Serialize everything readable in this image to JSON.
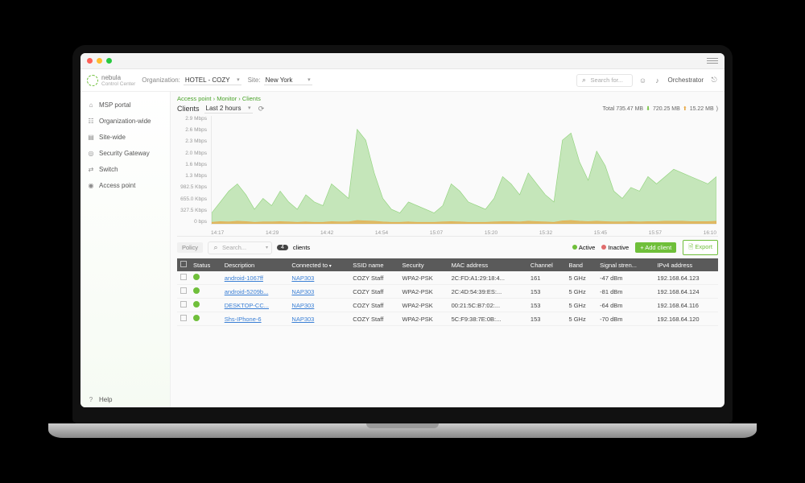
{
  "brand": {
    "name": "nebula",
    "sub": "Control Center"
  },
  "topbar": {
    "org_label": "Organization:",
    "org_value": "HOTEL - COZY",
    "site_label": "Site:",
    "site_value": "New York",
    "search_placeholder": "Search for...",
    "orchestrator": "Orchestrator"
  },
  "sidebar": {
    "items": [
      {
        "icon": "⌂",
        "label": "MSP portal"
      },
      {
        "icon": "☷",
        "label": "Organization-wide"
      },
      {
        "icon": "▤",
        "label": "Site-wide"
      },
      {
        "icon": "◎",
        "label": "Security Gateway"
      },
      {
        "icon": "⇄",
        "label": "Switch"
      },
      {
        "icon": "◉",
        "label": "Access point"
      }
    ],
    "help": {
      "icon": "?",
      "label": "Help"
    }
  },
  "breadcrumb": [
    "Access point",
    "Monitor",
    "Clients"
  ],
  "panel": {
    "title": "Clients",
    "range": "Last 2 hours",
    "total": "Total 735.47 MB",
    "down": "720.25 MB",
    "up": "15.22 MB"
  },
  "toolbar": {
    "policy": "Policy",
    "search": "Search...",
    "count": "4",
    "count_label": "clients",
    "active": "Active",
    "inactive": "Inactive",
    "add": "+ Add client",
    "export": "Export"
  },
  "columns": [
    "",
    "Status",
    "Description",
    "Connected to",
    "SSID name",
    "Security",
    "MAC address",
    "Channel",
    "Band",
    "Signal stren...",
    "IPv4 address"
  ],
  "rows": [
    {
      "desc": "android-1067ff",
      "ap": "NAP303",
      "ssid": "COZY Staff",
      "sec": "WPA2-PSK",
      "mac": "2C:FD:A1:29:18:4...",
      "ch": "161",
      "band": "5 GHz",
      "sig": "-47 dBm",
      "ip": "192.168.64.123"
    },
    {
      "desc": "android-5209b...",
      "ap": "NAP303",
      "ssid": "COZY Staff",
      "sec": "WPA2-PSK",
      "mac": "2C:4D:54:39:ES:...",
      "ch": "153",
      "band": "5 GHz",
      "sig": "-81 dBm",
      "ip": "192.168.64.124"
    },
    {
      "desc": "DESKTOP-CC...",
      "ap": "NAP303",
      "ssid": "COZY Staff",
      "sec": "WPA2-PSK",
      "mac": "00:21:5C:B7:02:...",
      "ch": "153",
      "band": "5 GHz",
      "sig": "-64 dBm",
      "ip": "192.168.64.116"
    },
    {
      "desc": "Shs-IPhone-6",
      "ap": "NAP303",
      "ssid": "COZY Staff",
      "sec": "WPA2-PSK",
      "mac": "5C:F9:38:7E:0B:...",
      "ch": "153",
      "band": "5 GHz",
      "sig": "-70 dBm",
      "ip": "192.168.64.120"
    }
  ],
  "chart_data": {
    "type": "area",
    "title": "",
    "xlabel": "",
    "ylabel": "",
    "yticks": [
      "2.9 Mbps",
      "2.6 Mbps",
      "2.3 Mbps",
      "2.0 Mbps",
      "1.6 Mbps",
      "1.3 Mbps",
      "982.5 Kbps",
      "655.0 Kbps",
      "327.5 Kbps",
      "0 bps"
    ],
    "xticks": [
      "14:17",
      "14:29",
      "14:42",
      "14:54",
      "15:07",
      "15:20",
      "15:32",
      "15:45",
      "15:57",
      "16:10"
    ],
    "ylim_kbps": [
      0,
      2970
    ],
    "series": [
      {
        "name": "download",
        "color": "#8fd27a",
        "values_kbps": [
          300,
          600,
          900,
          1100,
          800,
          400,
          700,
          500,
          900,
          600,
          400,
          800,
          600,
          500,
          1100,
          900,
          700,
          2600,
          2300,
          1400,
          700,
          400,
          300,
          600,
          500,
          400,
          300,
          500,
          1100,
          900,
          600,
          500,
          400,
          700,
          1300,
          1100,
          800,
          1400,
          1100,
          800,
          600,
          2300,
          2500,
          1700,
          1200,
          2000,
          1600,
          900,
          700,
          1000,
          900,
          1300,
          1100,
          1300,
          1500,
          1400,
          1300,
          1200,
          1100,
          1300
        ]
      },
      {
        "name": "upload",
        "color": "#e8a845",
        "values_kbps": [
          40,
          60,
          50,
          70,
          60,
          40,
          50,
          50,
          60,
          50,
          40,
          50,
          40,
          40,
          60,
          50,
          50,
          90,
          80,
          70,
          50,
          40,
          40,
          50,
          40,
          40,
          40,
          50,
          60,
          50,
          40,
          40,
          40,
          50,
          60,
          60,
          50,
          70,
          60,
          50,
          40,
          80,
          90,
          70,
          60,
          70,
          60,
          50,
          50,
          60,
          50,
          60,
          60,
          70,
          70,
          70,
          60,
          60,
          60,
          70
        ]
      }
    ]
  }
}
